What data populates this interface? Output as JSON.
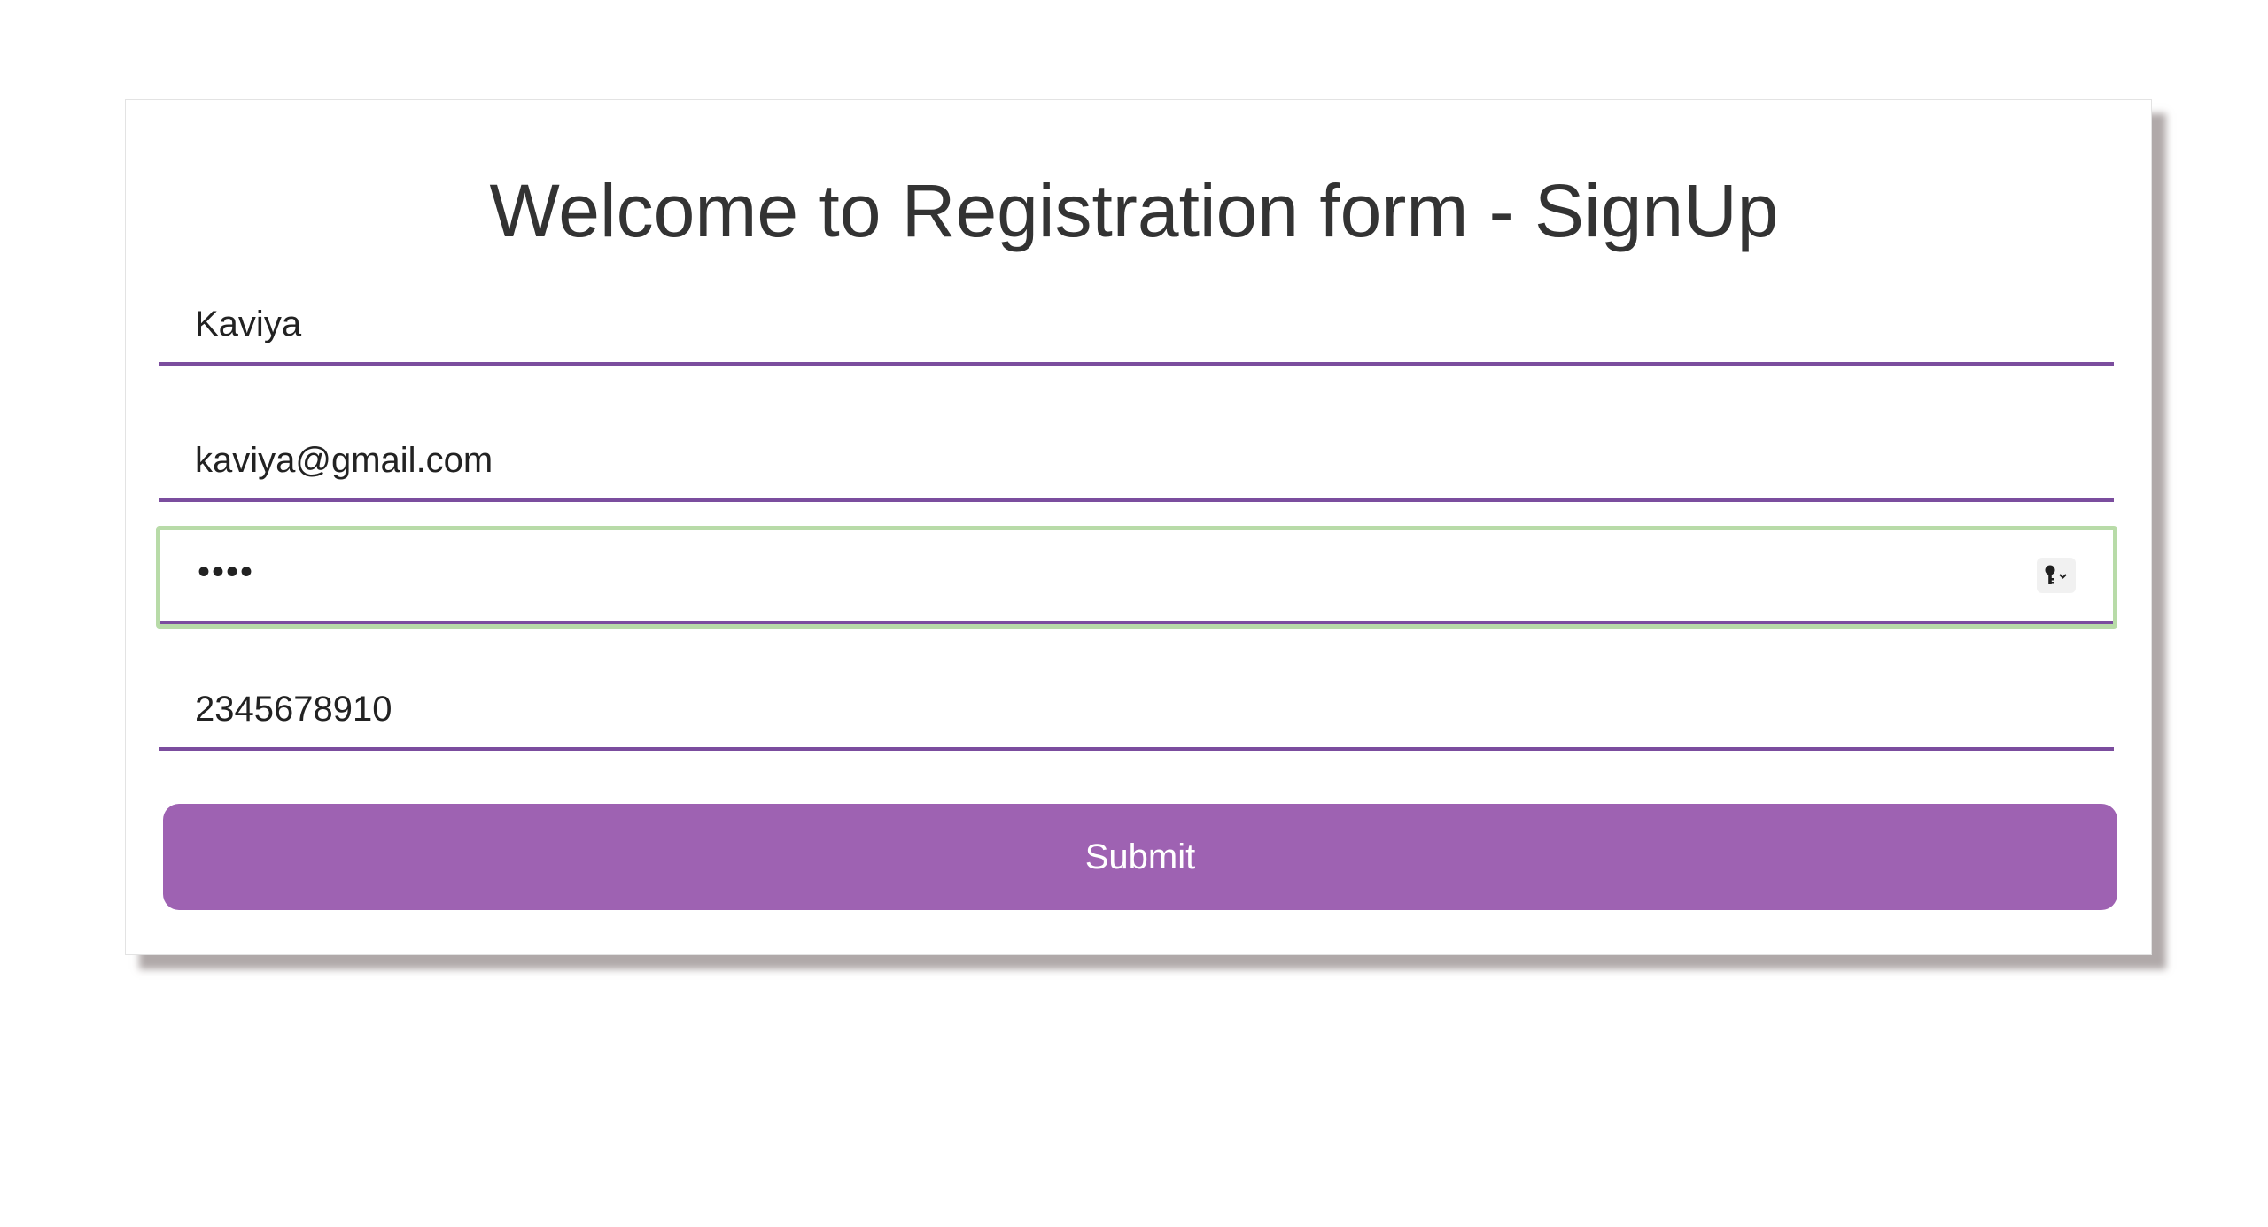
{
  "form": {
    "title": "Welcome to Registration form - SignUp",
    "fields": {
      "name": {
        "value": "Kaviya"
      },
      "email": {
        "value": "kaviya@gmail.com"
      },
      "password": {
        "value": "••••",
        "focused": true,
        "autofill_icon": "key-icon"
      },
      "phone": {
        "value": "2345678910"
      }
    },
    "submit_label": "Submit"
  },
  "colors": {
    "accent": "#9e62b2",
    "underline": "#7b4d9e",
    "focus_ring": "#b8dba8",
    "title_text": "#333333"
  }
}
